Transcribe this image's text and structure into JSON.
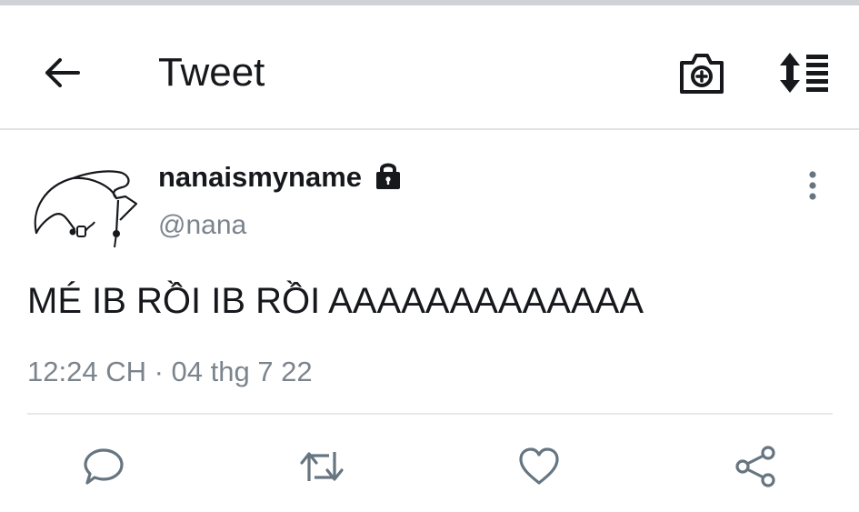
{
  "appbar": {
    "title": "Tweet",
    "icons": {
      "back": "arrow-left-icon",
      "camera": "camera-plus-icon",
      "sort": "sort-lines-icon"
    }
  },
  "tweet": {
    "author": {
      "display_name": "nanaismyname",
      "handle": "@nana",
      "protected": true
    },
    "text": "MÉ IB RỒI IB RỒI AAAAAAAAAAAAA",
    "timestamp": "12:24 CH · 04 thg 7 22"
  },
  "actions": [
    "reply",
    "retweet",
    "like",
    "share"
  ],
  "colors": {
    "text_primary": "#16181c",
    "text_secondary": "#7b848d",
    "icon_gray": "#667580",
    "divider": "#e1e4e7"
  }
}
